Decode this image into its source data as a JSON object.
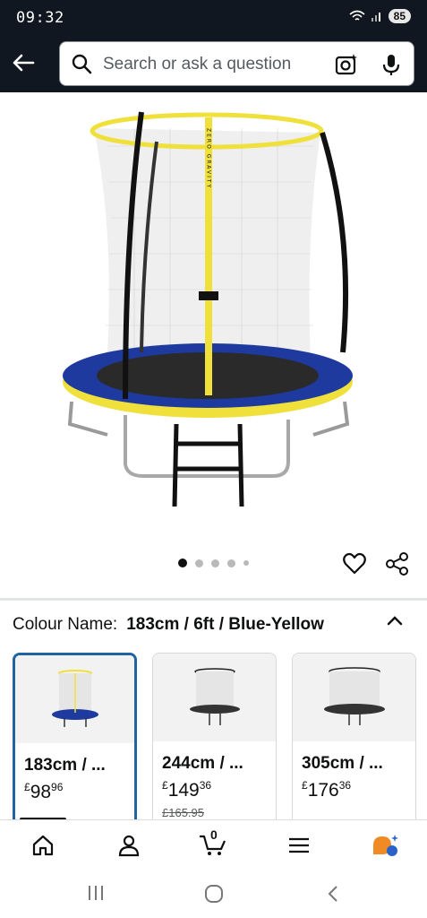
{
  "status_bar": {
    "time": "09:32",
    "battery": "85"
  },
  "search": {
    "placeholder": "Search or ask a question"
  },
  "hero": {
    "net_strap_text": "ZERO GRAVITY",
    "image_count": 5,
    "active_index": 0
  },
  "variation": {
    "label": "Colour Name:",
    "value": "183cm / 6ft / Blue-Yellow",
    "options": [
      {
        "title": "183cm / ...",
        "currency": "£",
        "price_whole": "98",
        "price_frac": "96",
        "was": ""
      },
      {
        "title": "244cm / ...",
        "currency": "£",
        "price_whole": "149",
        "price_frac": "36",
        "was": "£165.95"
      },
      {
        "title": "305cm / ...",
        "currency": "£",
        "price_whole": "176",
        "price_frac": "36",
        "was": ""
      }
    ]
  },
  "bottom_nav": {
    "cart_count": "0"
  },
  "colors": {
    "header_bg": "#111720",
    "selected_border": "#2162a1",
    "rim_yellow": "#f0e03c",
    "mat_blue": "#1e3a9e"
  }
}
